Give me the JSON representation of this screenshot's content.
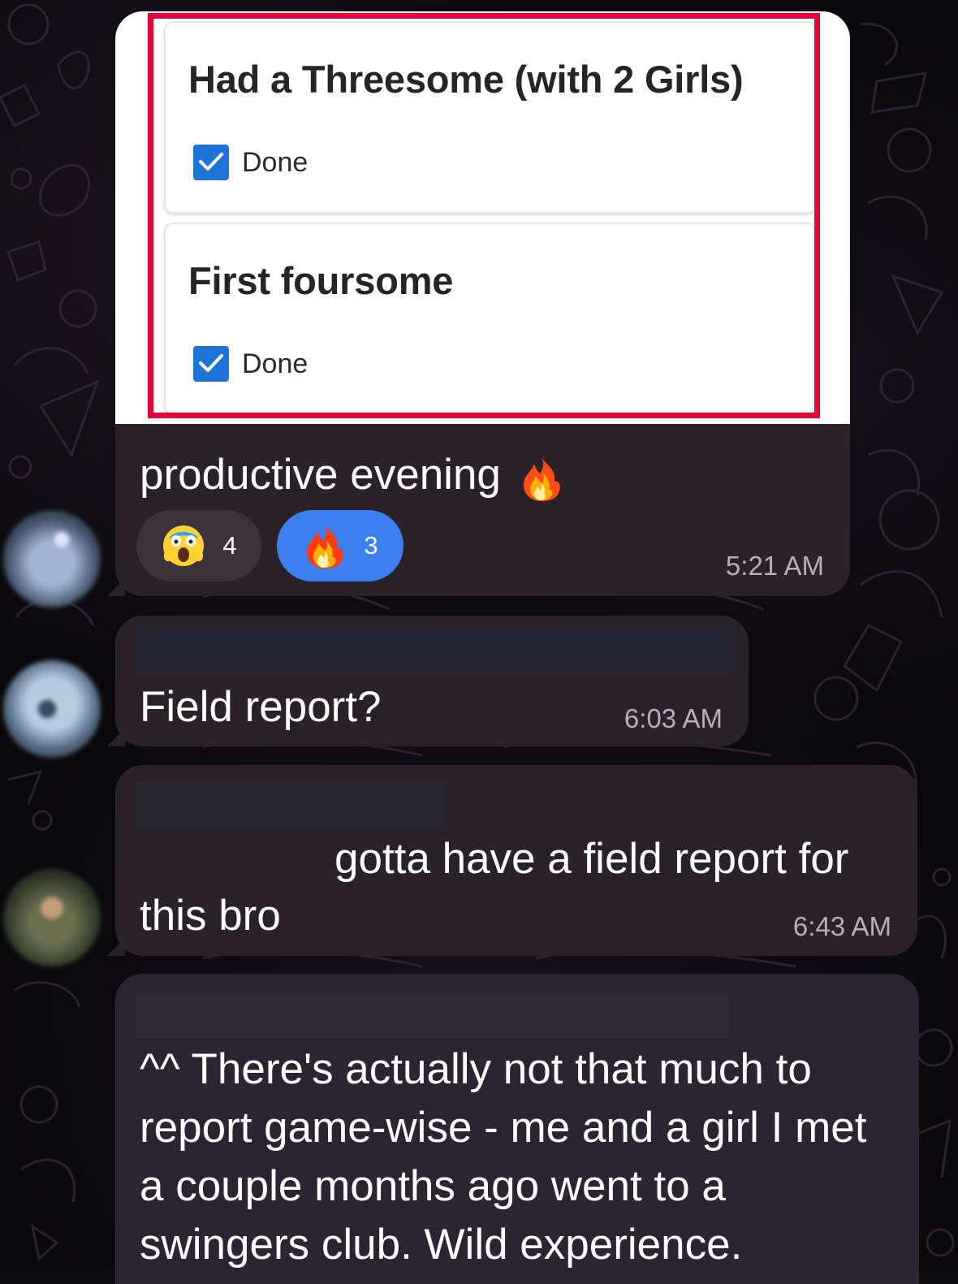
{
  "messages": [
    {
      "image_cards": [
        {
          "title": "Had a Threesome (with 2 Girls)",
          "status": "Done"
        },
        {
          "title": "First foursome",
          "status": "Done"
        }
      ],
      "caption": "productive evening",
      "reactions": [
        {
          "emoji": "scream-emoji",
          "count": "4"
        },
        {
          "emoji": "fire-emoji",
          "count": "3"
        }
      ],
      "timestamp": "5:21 AM"
    },
    {
      "text": "Field report?",
      "timestamp": "6:03 AM"
    },
    {
      "line1": "gotta have a field report for",
      "line2": "this bro",
      "timestamp": "6:43 AM"
    },
    {
      "text": "^^ There's actually not that much to report game-wise - me and a girl I met a couple months ago went to a swingers club. Wild experience."
    }
  ],
  "icons": {
    "checkbox": "check-icon",
    "caption_emoji": "fire-emoji",
    "reaction_emojis": [
      "scream-emoji",
      "fire-emoji"
    ]
  },
  "colors": {
    "background": "#0b0a0d",
    "bubble": "#2a2228",
    "reaction_active": "#3d7ff0",
    "highlight_border": "#e5053a",
    "checkbox": "#1e73d8",
    "timestamp": "#b9adb7"
  }
}
